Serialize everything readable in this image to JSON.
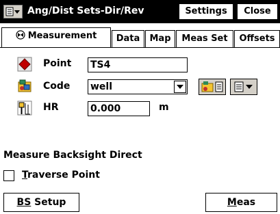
{
  "titlebar": {
    "title": "Ang/Dist Sets-Dir/Rev",
    "settings_label": "Settings",
    "close_label": "Close"
  },
  "tabs": [
    {
      "label": "Measurement",
      "icon": "satellite-icon",
      "active": true
    },
    {
      "label": "Data"
    },
    {
      "label": "Map"
    },
    {
      "label": "Meas Set"
    },
    {
      "label": "Offsets"
    }
  ],
  "form": {
    "point_label": "Point",
    "point_value": "TS4",
    "code_label": "Code",
    "code_value": "well",
    "hr_label": "HR",
    "hr_value": "0.000",
    "hr_unit": "m"
  },
  "status_text": "Measure Backsight Direct",
  "traverse": {
    "first_letter": "T",
    "rest": "raverse Point",
    "checked": false
  },
  "buttons": {
    "bs_setup_first": "BS",
    "bs_setup_rest": " Setup",
    "meas_first": "M",
    "meas_rest": "eas"
  },
  "colors": {
    "titlebar_bg": "#000000",
    "point_icon": "#c00000",
    "button_face": "#d4d0c8"
  }
}
